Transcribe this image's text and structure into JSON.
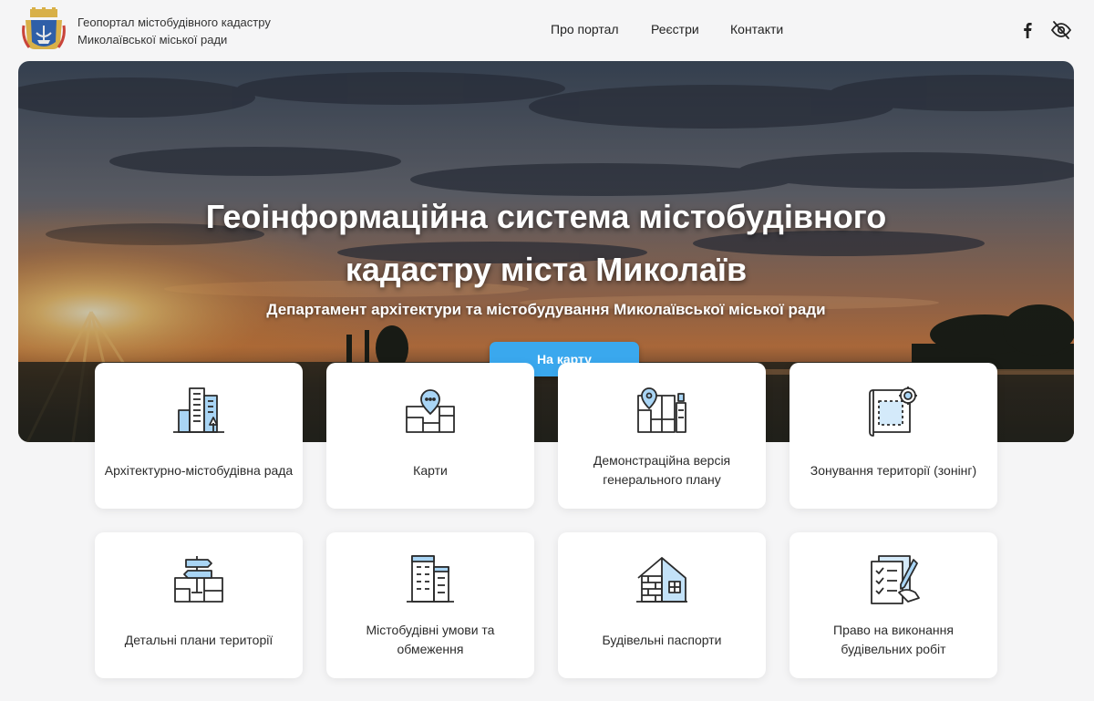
{
  "header": {
    "title_line1": "Геопортал містобудівного кадастру",
    "title_line2": "Миколаївської міської ради",
    "nav": [
      "Про портал",
      "Реєстри",
      "Контакти"
    ],
    "icons": [
      "facebook-icon",
      "visibility-off-icon"
    ]
  },
  "hero": {
    "title_line1": "Геоінформаційна система містобудівного",
    "title_line2": "кадастру міста Миколаїв",
    "subtitle": "Департамент архітектури та містобудування Миколаївської міської ради",
    "button": "На карту"
  },
  "cards": [
    {
      "label": "Архітектурно-містобудівна рада",
      "icon": "city-buildings-icon"
    },
    {
      "label": "Карти",
      "icon": "map-pin-icon"
    },
    {
      "label": "Демонстраційна версія генерального плану",
      "icon": "master-plan-icon"
    },
    {
      "label": "Зонування території (зонінг)",
      "icon": "zoning-blueprint-icon"
    },
    {
      "label": "Детальні плани території",
      "icon": "signpost-map-icon"
    },
    {
      "label": "Містобудівні умови та обмеження",
      "icon": "skyscrapers-icon"
    },
    {
      "label": "Будівельні паспорти",
      "icon": "house-construction-icon"
    },
    {
      "label": "Право на виконання будівельних робіт",
      "icon": "checklist-document-icon"
    }
  ],
  "colors": {
    "accent": "#3aa8ee",
    "icon_stroke": "#2b2b2b",
    "icon_fill": "#a9d5f5"
  }
}
